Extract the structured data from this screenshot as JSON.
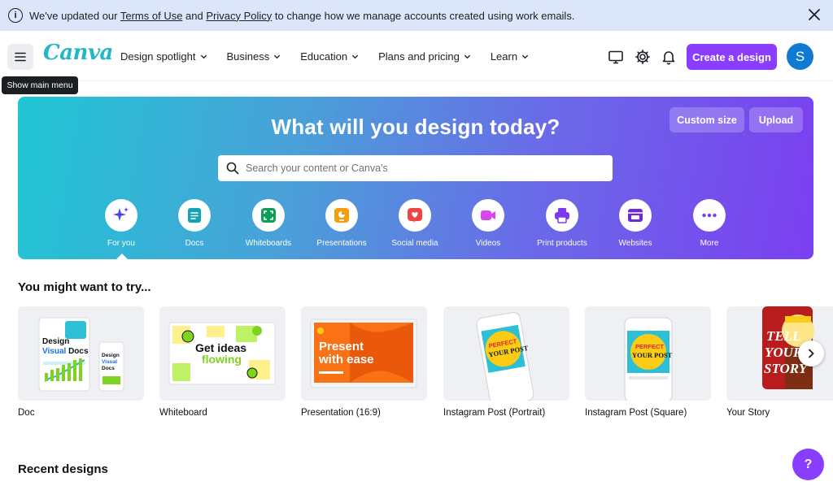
{
  "banner": {
    "text_before": "We've updated our ",
    "terms_link": "Terms of Use",
    "and": " and ",
    "privacy_link": "Privacy Policy",
    "text_after": " to change how we manage accounts created using work emails."
  },
  "nav": {
    "logo": "Canva",
    "tooltip": "Show main menu",
    "menu": [
      "Design spotlight",
      "Business",
      "Education",
      "Plans and pricing",
      "Learn"
    ],
    "create_button": "Create a design",
    "avatar_initial": "S"
  },
  "hero": {
    "title": "What will you design today?",
    "custom_size": "Custom size",
    "upload": "Upload",
    "search_placeholder": "Search your content or Canva's",
    "categories": [
      {
        "label": "For you",
        "icon": "sparkle-icon",
        "color": "#4f46e5"
      },
      {
        "label": "Docs",
        "icon": "doc-icon",
        "color": "#13a3b5"
      },
      {
        "label": "Whiteboards",
        "icon": "whiteboard-icon",
        "color": "#0f9d58"
      },
      {
        "label": "Presentations",
        "icon": "presentation-icon",
        "color": "#f59e0b"
      },
      {
        "label": "Social media",
        "icon": "heart-icon",
        "color": "#ef4444"
      },
      {
        "label": "Videos",
        "icon": "video-icon",
        "color": "#d946ef"
      },
      {
        "label": "Print products",
        "icon": "printer-icon",
        "color": "#7c3aed"
      },
      {
        "label": "Websites",
        "icon": "website-icon",
        "color": "#6d28d9"
      },
      {
        "label": "More",
        "icon": "more-icon",
        "color": "#7c3aed"
      }
    ]
  },
  "try_section": {
    "title": "You might want to try...",
    "cards": [
      {
        "label": "Doc",
        "thumb_text": "Design Visual Docs"
      },
      {
        "label": "Whiteboard",
        "thumb_text": "Get ideas flowing"
      },
      {
        "label": "Presentation (16:9)",
        "thumb_text": "Present with ease"
      },
      {
        "label": "Instagram Post (Portrait)",
        "thumb_text": "PERFECT YOUR POST"
      },
      {
        "label": "Instagram Post (Square)",
        "thumb_text": "PERFECT YOUR POST"
      },
      {
        "label": "Your Story",
        "thumb_text": "TELL YOUR STORY"
      }
    ]
  },
  "recent": {
    "title": "Recent designs"
  },
  "help": "?",
  "colors": {
    "brand": "#8b3dff",
    "logo": "#22b6c7",
    "banner": "#dbe6fb"
  }
}
